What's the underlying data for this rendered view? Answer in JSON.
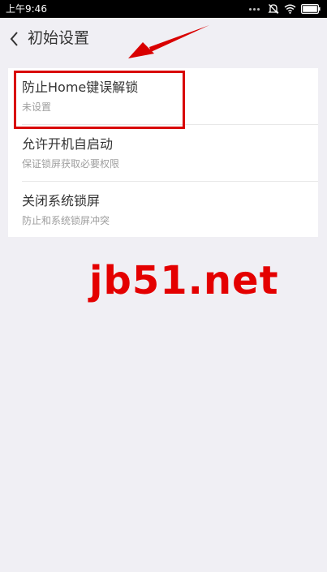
{
  "status_bar": {
    "time": "上午9:46"
  },
  "header": {
    "title": "初始设置"
  },
  "settings": {
    "items": [
      {
        "title": "防止Home键误解锁",
        "subtitle": "未设置"
      },
      {
        "title": "允许开机自启动",
        "subtitle": "保证锁屏获取必要权限"
      },
      {
        "title": "关闭系统锁屏",
        "subtitle": "防止和系统锁屏冲突"
      }
    ]
  },
  "watermark": {
    "text": "jb51.net"
  },
  "icons": {
    "back": "chevron-left-icon",
    "mute": "mute-icon",
    "wifi": "wifi-icon",
    "battery": "battery-icon"
  },
  "colors": {
    "annotation_red": "#d90000",
    "watermark_red": "#e40000",
    "background": "#f0eff4",
    "card": "#ffffff"
  }
}
